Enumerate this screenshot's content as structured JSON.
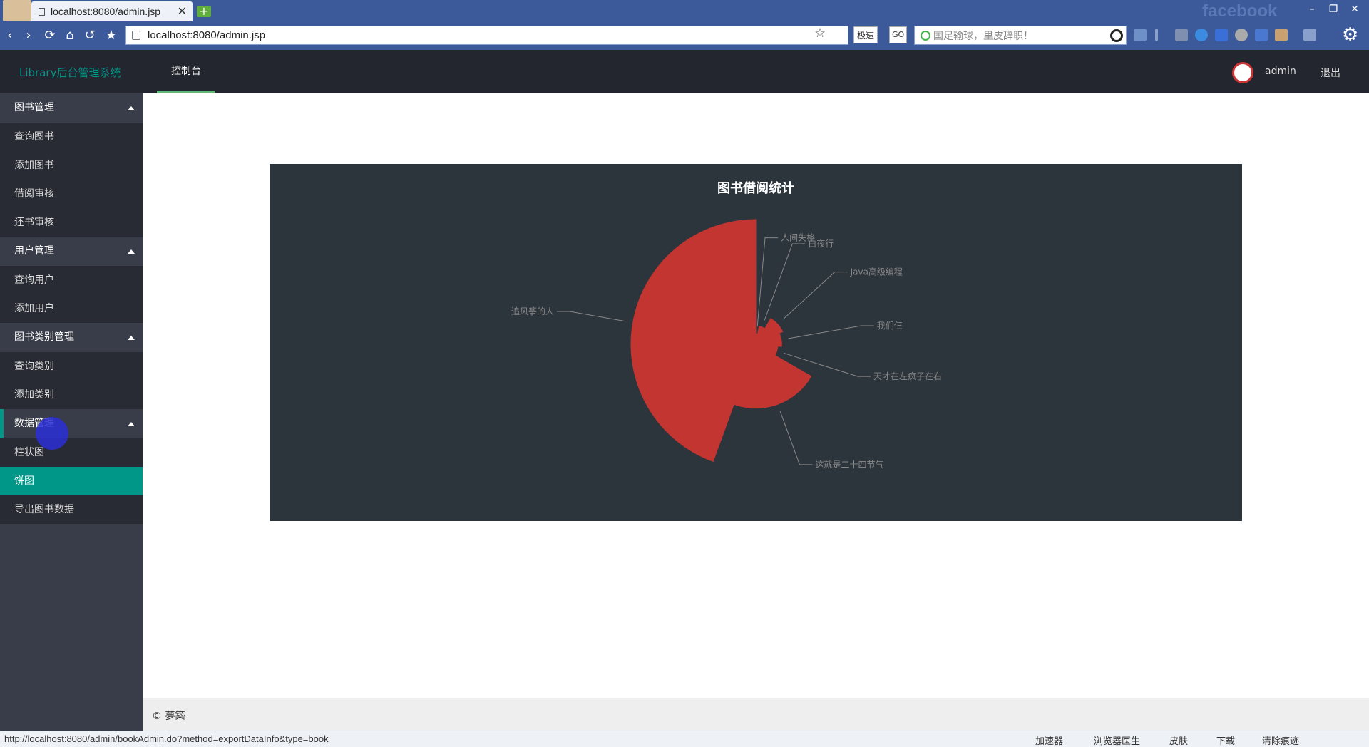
{
  "browser": {
    "tab_title": "localhost:8080/admin.jsp",
    "url": "localhost:8080/admin.jsp",
    "speed_label": "极速",
    "go_label": "GO",
    "search_placeholder": "国足输球，里皮辞职！",
    "facebook_watermark": "facebook"
  },
  "header": {
    "logo": "Library后台管理系统",
    "nav_console": "控制台",
    "username": "admin",
    "logout": "退出"
  },
  "sidebar": {
    "groups": [
      {
        "label": "图书管理",
        "items": [
          "查询图书",
          "添加图书",
          "借阅审核",
          "还书审核"
        ]
      },
      {
        "label": "用户管理",
        "items": [
          "查询用户",
          "添加用户"
        ]
      },
      {
        "label": "图书类别管理",
        "items": [
          "查询类别",
          "添加类别"
        ]
      },
      {
        "label": "数据管理",
        "items": [
          "柱状图",
          "饼图",
          "导出图书数据"
        ]
      }
    ],
    "selected_item": "饼图"
  },
  "chart_data": {
    "type": "pie",
    "subtype": "rose",
    "title": "图书借阅统计",
    "categories": [
      "人间失格",
      "白夜行",
      "Java高级编程",
      "我们仨",
      "天才在左疯子在右",
      "这就是二十四节气",
      "追风筝的人"
    ],
    "values": [
      2,
      4,
      7,
      6,
      5,
      16,
      32
    ],
    "colors": {
      "background": "#2c343c",
      "slice": "#c23531",
      "label": "#888888"
    }
  },
  "footer": {
    "copyright": "© 夢築"
  },
  "statusbar": {
    "link_preview": "http://localhost:8080/admin/bookAdmin.do?method=exportDataInfo&type=book",
    "items": [
      "加速器",
      "浏览器医生",
      "皮肤",
      "下载",
      "清除痕迹"
    ]
  }
}
